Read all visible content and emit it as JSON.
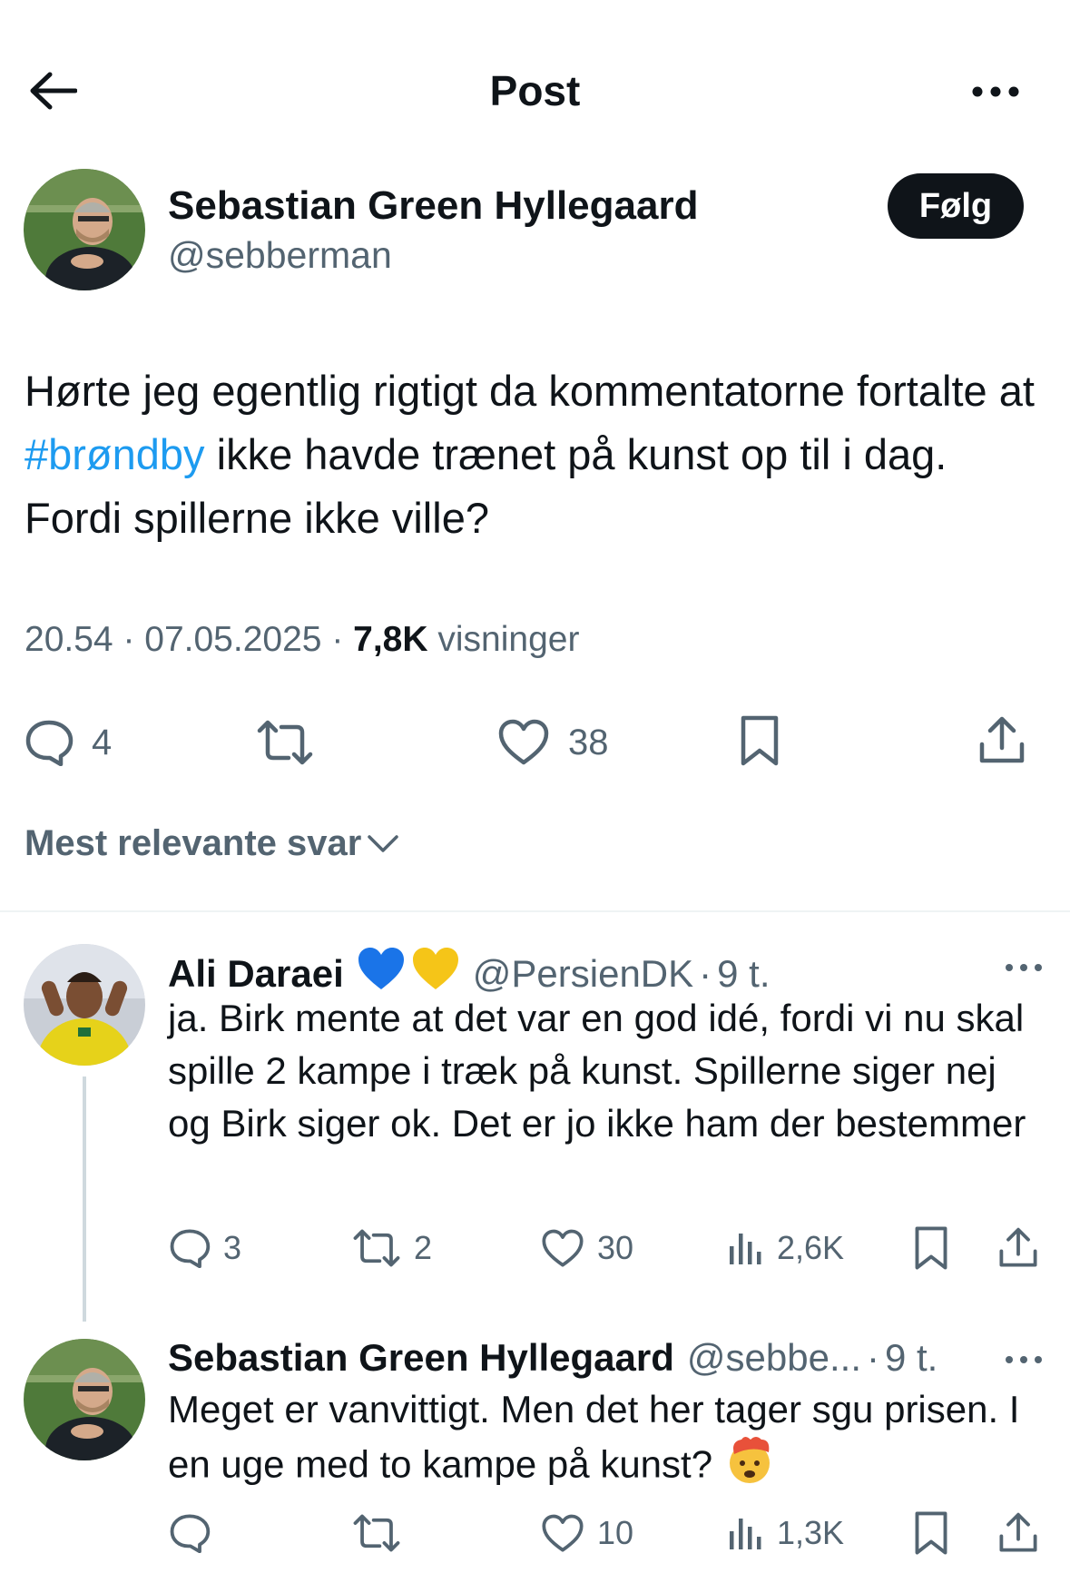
{
  "header": {
    "title": "Post",
    "back_icon": "arrow-left-icon",
    "more_icon": "more-horizontal-icon"
  },
  "post": {
    "author_name": "Sebastian Green Hyllegaard",
    "author_handle": "@sebberman",
    "follow_label": "Følg",
    "text_part1": "Hørte jeg egentlig rigtigt da kommentatorne fortalte at ",
    "hashtag": "#brøndby",
    "text_part2": " ikke havde trænet på kunst op til i dag. Fordi spillerne ikke ville?",
    "time": "20.54",
    "date": "07.05.2025",
    "views_count": "7,8K",
    "views_label": "visninger",
    "reply_count": "4",
    "like_count": "38"
  },
  "sort": {
    "label": "Mest relevante svar"
  },
  "replies": [
    {
      "name": "Ali Daraei",
      "emoji": [
        "blue-heart",
        "yellow-heart"
      ],
      "handle": "@PersienDK",
      "dot": "·",
      "time": "9 t.",
      "text": "ja. Birk mente at det var en god idé, fordi vi nu skal spille 2 kampe i træk på kunst. Spillerne siger nej og Birk siger ok. Det er jo ikke ham der bestemmer",
      "reply_count": "3",
      "retweet_count": "2",
      "like_count": "30",
      "views_count": "2,6K"
    },
    {
      "name": "Sebastian Green Hyllegaard",
      "handle": "@sebbe...",
      "dot": "·",
      "time": "9 t.",
      "text": "Meget er vanvittigt. Men det her tager sgu prisen. I en uge med to kampe på kunst?",
      "emoji": "exploding-head",
      "reply_count": "",
      "retweet_count": "",
      "like_count": "10",
      "views_count": "1,3K"
    }
  ],
  "colors": {
    "text": "#0f1419",
    "secondary": "#536471",
    "link": "#1d9bf0",
    "divider": "#eff3f4",
    "thread_line": "#cfd9de"
  }
}
